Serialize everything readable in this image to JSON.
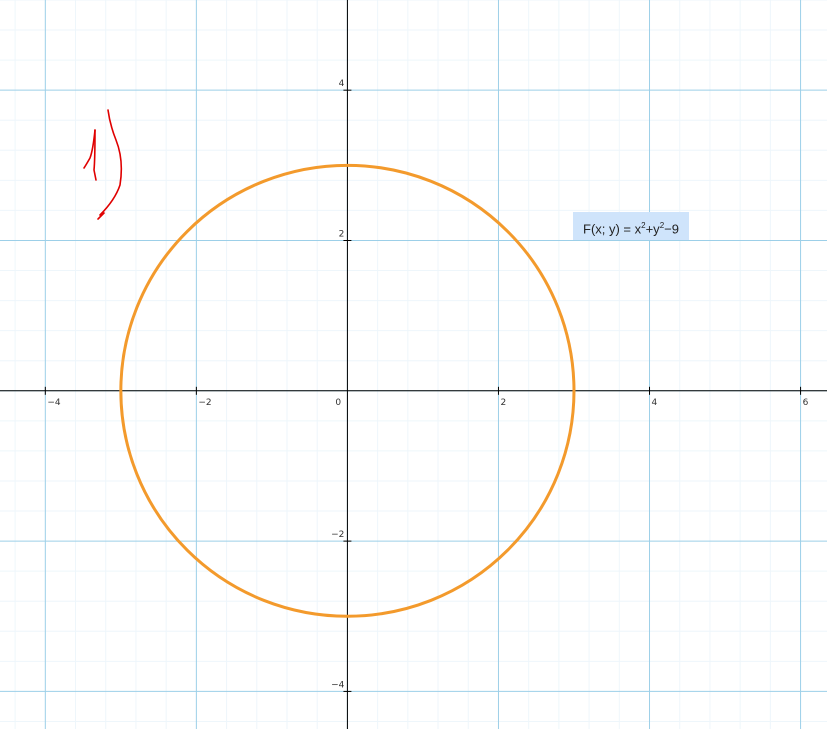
{
  "graph": {
    "x_range": [
      -4.6,
      6.35
    ],
    "y_range": [
      -4.5,
      5.2
    ],
    "major_step": 2,
    "minor_step": 0.4,
    "x_tick_labels": [
      "−4",
      "−2",
      "0",
      "2",
      "4",
      "6"
    ],
    "y_tick_labels": [
      "4",
      "2",
      "−2",
      "−4"
    ],
    "colors": {
      "major_grid": "#9ccfe8",
      "minor_grid": "#eef6fb",
      "axis": "#000000",
      "curve": "#f39a2c",
      "ink": "#e00000",
      "label_bg": "#cfe4fb"
    }
  },
  "curve": {
    "type": "implicit-circle",
    "center": [
      0,
      0
    ],
    "radius": 3
  },
  "function_label": {
    "prefix": "F(x; y) = x",
    "exp1": "2",
    "mid": "+y",
    "exp2": "2",
    "suffix": "−9"
  },
  "annotations": {
    "ink_strokes_icon": "handwritten-ink-strokes"
  }
}
